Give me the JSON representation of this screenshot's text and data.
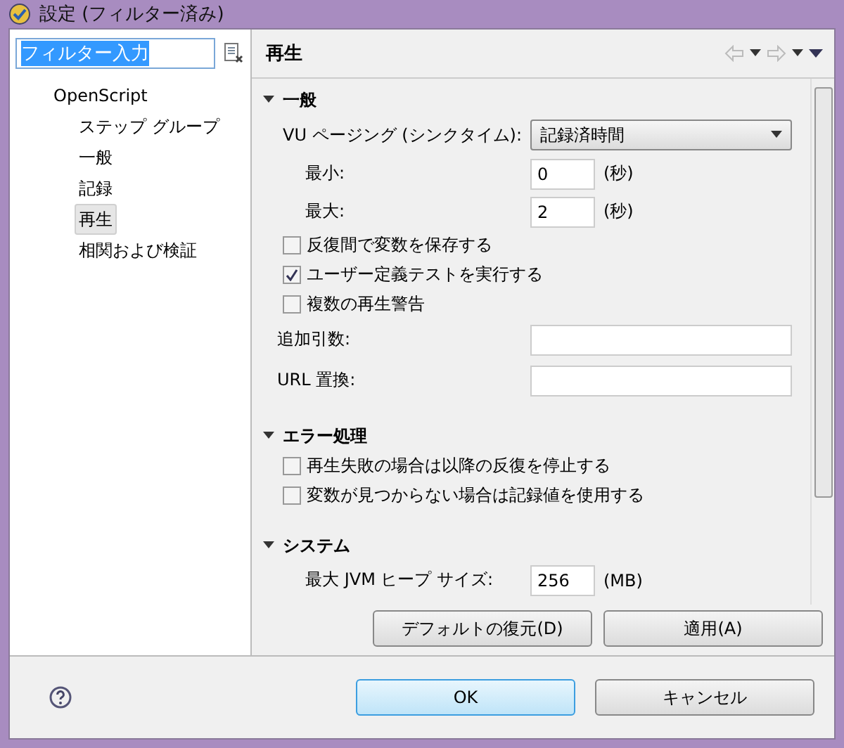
{
  "window": {
    "title": "設定 (フィルター済み)"
  },
  "filter": {
    "value": "フィルター入力"
  },
  "tree": [
    {
      "label": "OpenScript",
      "selected": false,
      "children": [
        {
          "label": "ステップ グループ",
          "selected": false
        },
        {
          "label": "一般",
          "selected": false
        },
        {
          "label": "記録",
          "selected": false
        },
        {
          "label": "再生",
          "selected": true
        },
        {
          "label": "相関および検証",
          "selected": false
        }
      ]
    }
  ],
  "page_title": "再生",
  "sections": [
    {
      "title": "一般",
      "expanded": true,
      "rows": [
        {
          "kind": "select",
          "label": "VU ページング (シンクタイム):",
          "value": "記録済時間"
        },
        {
          "kind": "number",
          "label": "最小:",
          "value": "0",
          "unit": "(秒)"
        },
        {
          "kind": "number",
          "label": "最大:",
          "value": "2",
          "unit": "(秒)"
        },
        {
          "kind": "checkbox",
          "label": "反復間で変数を保存する",
          "checked": false
        },
        {
          "kind": "checkbox",
          "label": "ユーザー定義テストを実行する",
          "checked": true
        },
        {
          "kind": "checkbox",
          "label": "複数の再生警告",
          "checked": false
        },
        {
          "kind": "text",
          "label": "追加引数:",
          "value": ""
        },
        {
          "kind": "text",
          "label": "URL 置換:",
          "value": ""
        }
      ]
    },
    {
      "title": "エラー処理",
      "expanded": true,
      "rows": [
        {
          "kind": "checkbox",
          "label": "再生失敗の場合は以降の反復を停止する",
          "checked": false
        },
        {
          "kind": "checkbox",
          "label": "変数が見つからない場合は記録値を使用する",
          "checked": false
        }
      ]
    },
    {
      "title": "システム",
      "expanded": true,
      "rows": [
        {
          "kind": "number",
          "label": "最大 JVM ヒープ サイズ:",
          "value": "256",
          "unit": "(MB)"
        }
      ]
    }
  ],
  "page_buttons": [
    "デフォルトの復元(D)",
    "適用(A)"
  ],
  "dialog_buttons": [
    {
      "label": "OK",
      "default": true
    },
    {
      "label": "キャンセル",
      "default": false
    }
  ]
}
